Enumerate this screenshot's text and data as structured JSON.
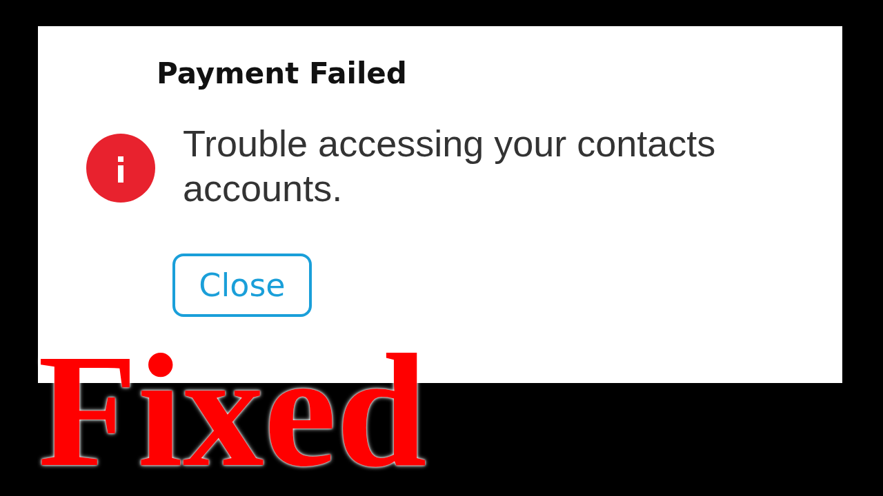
{
  "dialog": {
    "title": "Payment Failed",
    "message": "Trouble accessing your contacts accounts.",
    "buttons": [
      {
        "label": "Close"
      }
    ]
  },
  "overlay_caption": "Fixed"
}
